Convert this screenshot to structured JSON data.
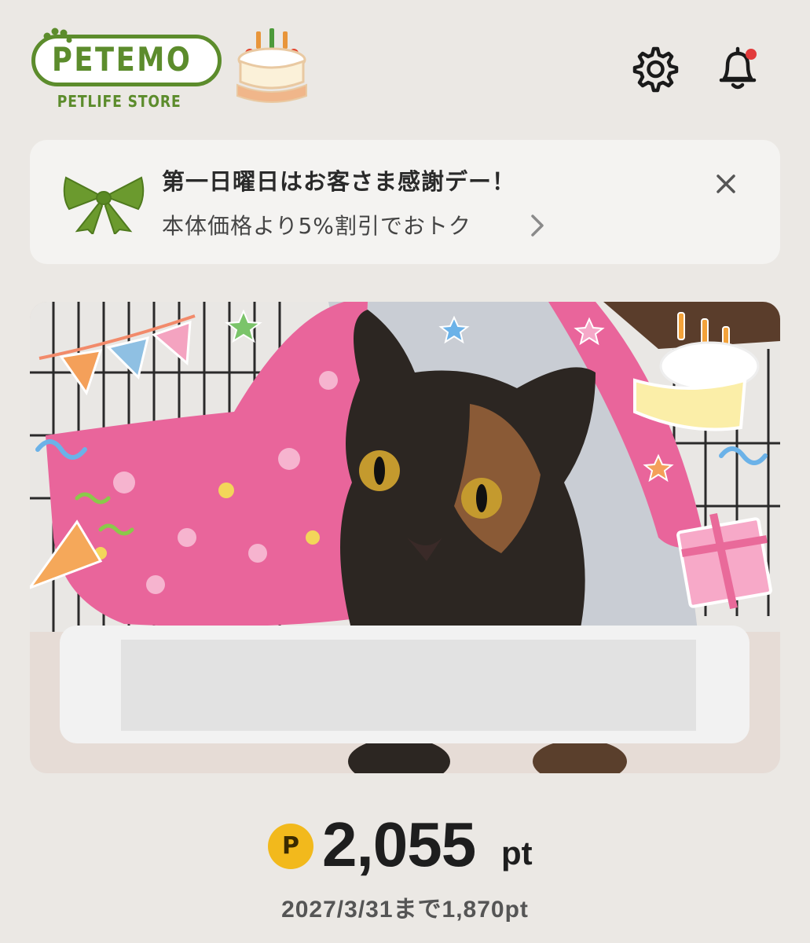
{
  "header": {
    "logo_name": "PETEMO",
    "logo_sub": "PETLIFE STORE",
    "icons": [
      "birthday-cake-icon",
      "gear-icon",
      "bell-icon"
    ],
    "notification_dot": true
  },
  "banner": {
    "title": "第一日曜日はお客さま感謝デー！",
    "subtitle": "本体価格より5%割引でおトク",
    "icons": [
      "ribbon-icon",
      "chevron-right-icon",
      "close-icon"
    ]
  },
  "pet_card": {
    "photo": "tortoiseshell cat under pink blanket with birthday decorations",
    "name_value": ""
  },
  "points": {
    "value": "2,055",
    "unit": "pt",
    "icon_letter": "P",
    "expiry_note": "2027/3/31まで1,870pt"
  },
  "colors": {
    "brand_green": "#5c8c2c",
    "coin_yellow": "#f2b91c",
    "background": "#ebe8e4",
    "notification_red": "#e23b3b"
  }
}
